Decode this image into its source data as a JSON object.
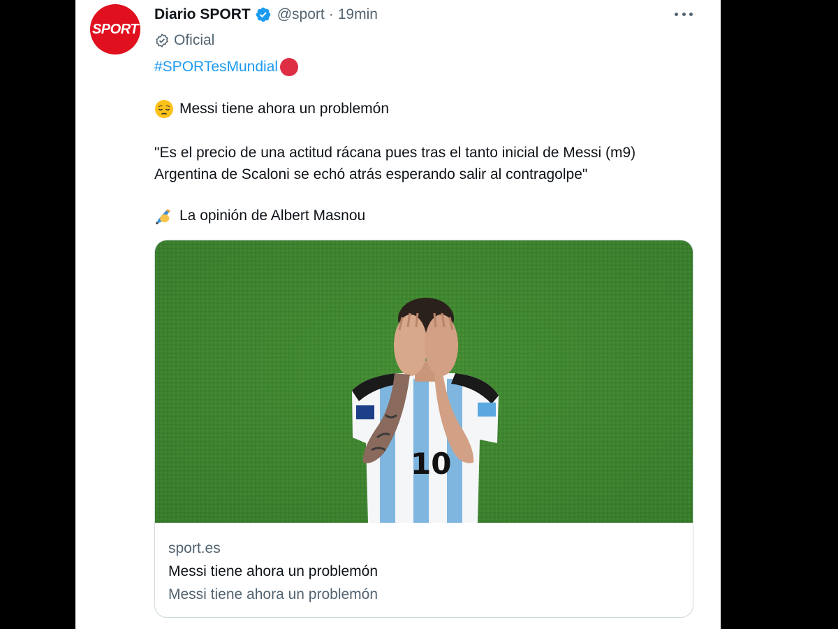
{
  "tweet": {
    "display_name": "Diario SPORT",
    "handle": "@sport",
    "separator": "·",
    "time": "19min",
    "official_label": "Oficial",
    "hashtag": "#SPORTesMundial",
    "line1": "Messi tiene ahora un problemón",
    "quote_line1": "\"Es el precio de una actitud rácana pues tras el tanto inicial de Messi (m9)",
    "quote_line2": "Argentina de Scaloni se echó atrás esperando salir al contragolpe\"",
    "line_author": "La opinión de Albert Masnou"
  },
  "avatar": {
    "logo_text": "SPORT",
    "color": "#e0101e"
  },
  "card": {
    "domain": "sport.es",
    "title": "Messi tiene ahora un problemón",
    "description": "Messi tiene ahora un problemón",
    "jersey_number": "10"
  },
  "colors": {
    "link": "#1d9bf0",
    "verified": "#1d9bf0",
    "muted": "#536471",
    "text": "#0f1419"
  },
  "icons": [
    "verified-badge-icon",
    "more-options-icon",
    "official-check-icon",
    "red-circle-emoji",
    "pensive-face-emoji",
    "writing-hand-emoji"
  ]
}
